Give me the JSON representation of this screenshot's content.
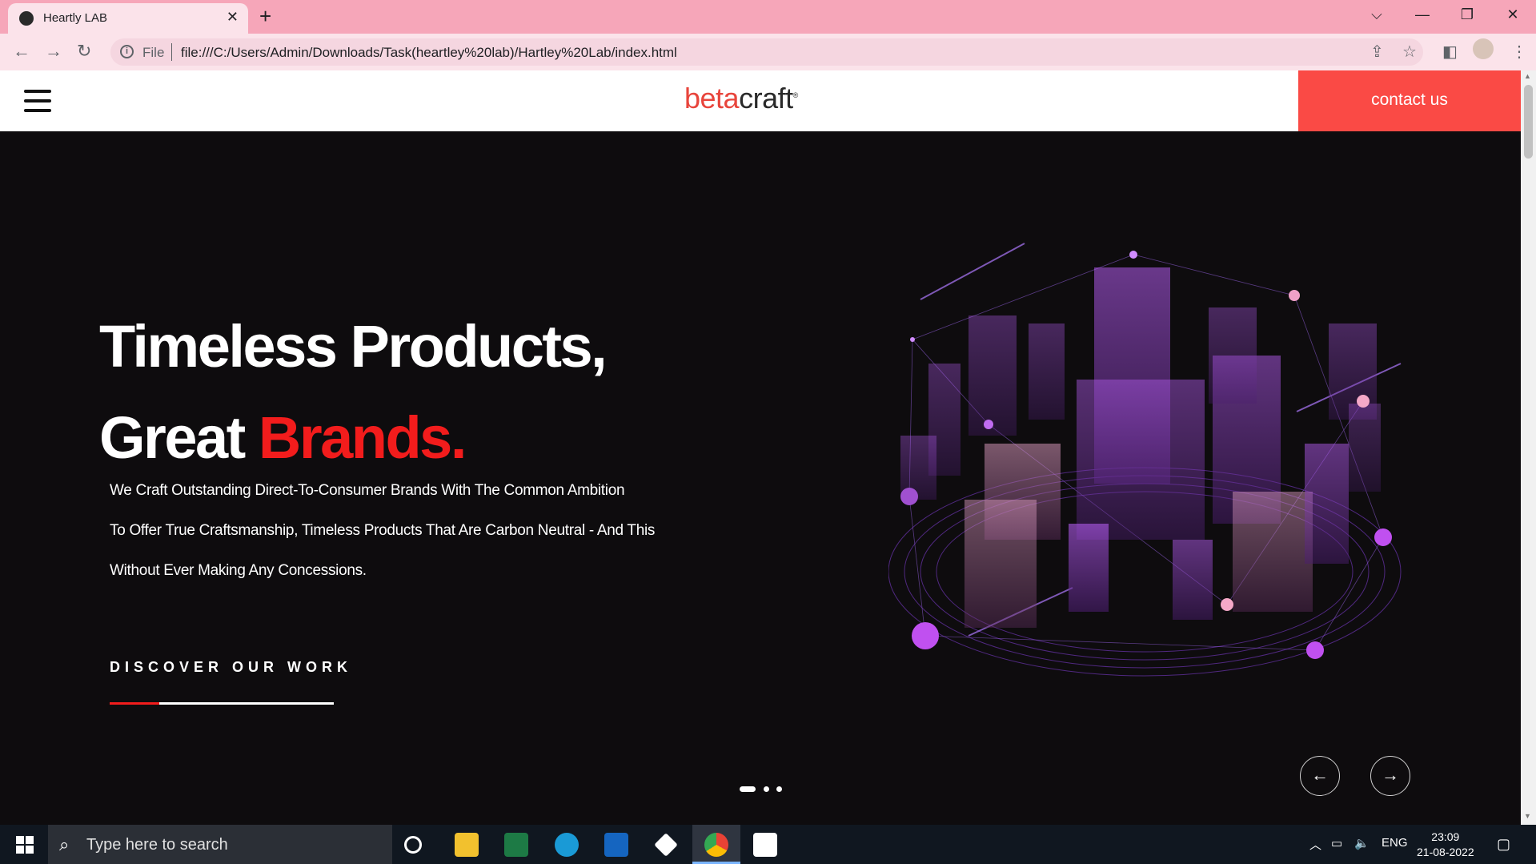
{
  "browser": {
    "tab_title": "Heartly LAB",
    "new_tab": "+",
    "close_tab": "✕",
    "window": {
      "chevron": "⌵",
      "minimize": "—",
      "restore": "❐",
      "close": "✕"
    },
    "address": {
      "scheme_label": "File",
      "url": "file:///C:/Users/Admin/Downloads/Task(heartley%20lab)/Hartley%20Lab/index.html"
    }
  },
  "site": {
    "logo": {
      "part1": "beta",
      "part2": "craft",
      "mark": "®"
    },
    "contact_label": "contact us",
    "hero": {
      "headline_line1": "Timeless Products,",
      "headline_line2_start": "Great ",
      "headline_line2_highlight": "Brands.",
      "description": [
        "We Craft Outstanding Direct-To-Consumer Brands With The Common Ambition",
        "To Offer True Craftsmanship, Timeless Products That Are Carbon Neutral - And This",
        "Without Ever Making Any Concessions."
      ],
      "cta": "DISCOVER OUR WORK",
      "slides_total": 3,
      "active_slide": 1
    },
    "colors": {
      "accent_red": "#f21c1c",
      "contact_bg": "#fa4a45",
      "hero_bg": "#0e0c0e"
    }
  },
  "taskbar": {
    "search_placeholder": "Type here to search",
    "lang": "ENG",
    "time": "23:09",
    "date": "21-08-2022",
    "apps": [
      "cortana-icon",
      "file-explorer-icon",
      "excel-icon",
      "edge-icon",
      "mail-icon",
      "dropbox-icon",
      "chrome-icon",
      "amazon-icon"
    ]
  }
}
